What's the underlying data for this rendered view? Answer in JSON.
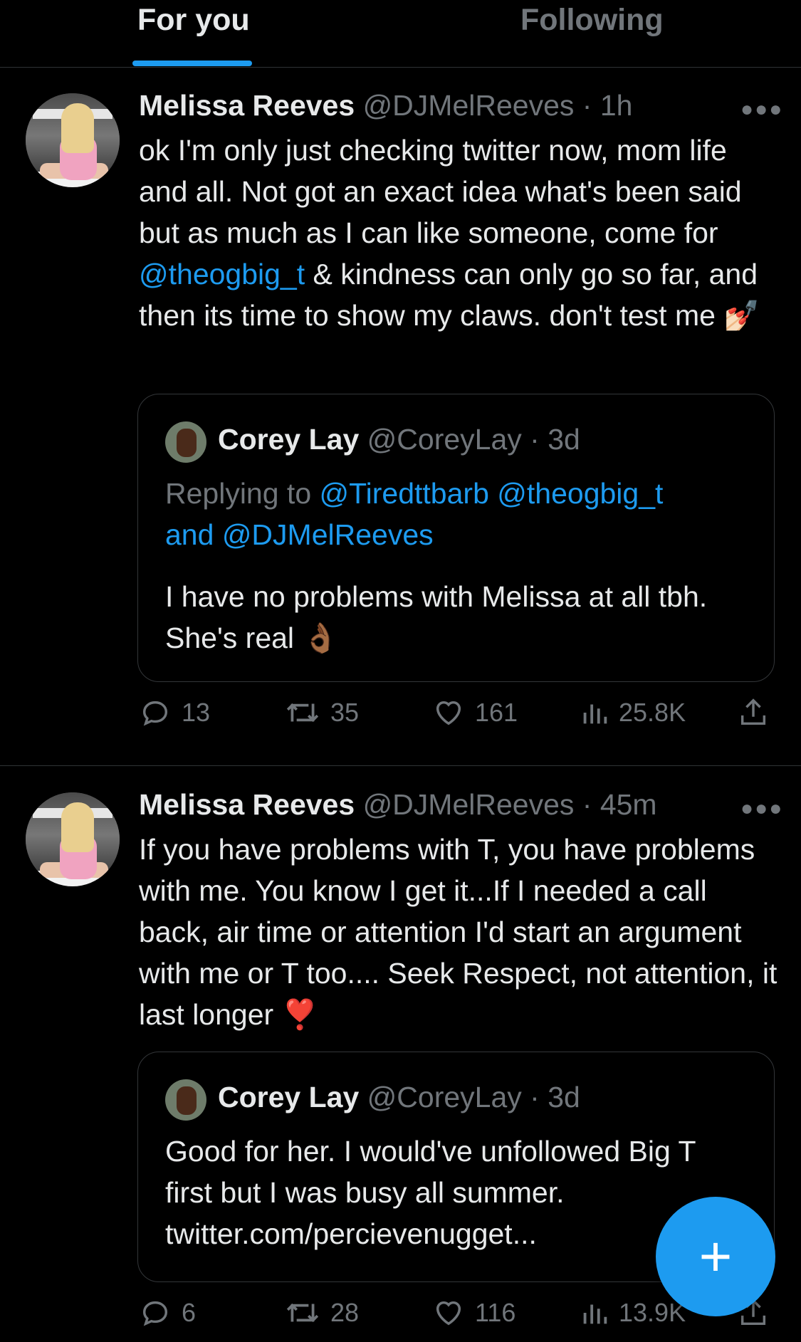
{
  "tabs": [
    {
      "label": "For you",
      "active": true
    },
    {
      "label": "Following",
      "active": false
    }
  ],
  "tweets": [
    {
      "name": "Melissa Reeves",
      "handle": "@DJMelReeves",
      "time": "1h",
      "text_parts": [
        "ok I'm only just checking twitter now, mom life and all. Not got an exact idea what's been said but as much as I can like someone, come for ",
        "@theogbig_t",
        " & kindness can only go so far, and then its time to show my claws. don't test me ",
        "💅🏻"
      ],
      "quote": {
        "name": "Corey Lay",
        "handle": "@CoreyLay",
        "time": "3d",
        "replying_prefix": "Replying to ",
        "replying_mentions": [
          "@Tiredttbarb",
          "@theogbig_t"
        ],
        "replying_and": "and ",
        "replying_last": "@DJMelReeves",
        "text": "I have no problems with Melissa at all tbh. She's real ",
        "emoji": "👌🏾"
      },
      "actions": {
        "replies": "13",
        "retweets": "35",
        "likes": "161",
        "views": "25.8K"
      }
    },
    {
      "name": "Melissa Reeves",
      "handle": "@DJMelReeves",
      "time": "45m",
      "text": "If you have problems with T, you have problems with me. You know I get it...If I needed a call back, air time or attention I'd start an argument with me or T too.... Seek Respect, not attention, it last longer ",
      "emoji": "❣️",
      "quote": {
        "name": "Corey Lay",
        "handle": "@CoreyLay",
        "time": "3d",
        "text": "Good for her. I would've unfollowed Big T first but I was busy all summer. twitter.com/percievenugget..."
      },
      "actions": {
        "replies": "6",
        "retweets": "28",
        "likes": "116",
        "views": "13.9K"
      }
    }
  ],
  "fab": {
    "label": "+"
  },
  "icons": {
    "more": "more-icon",
    "reply": "reply-icon",
    "retweet": "retweet-icon",
    "like": "like-icon",
    "views": "views-icon",
    "share": "share-icon"
  },
  "colors": {
    "accent": "#1d9bf0",
    "background": "#000000",
    "text": "#e7e9ea",
    "secondary": "#71767b"
  }
}
